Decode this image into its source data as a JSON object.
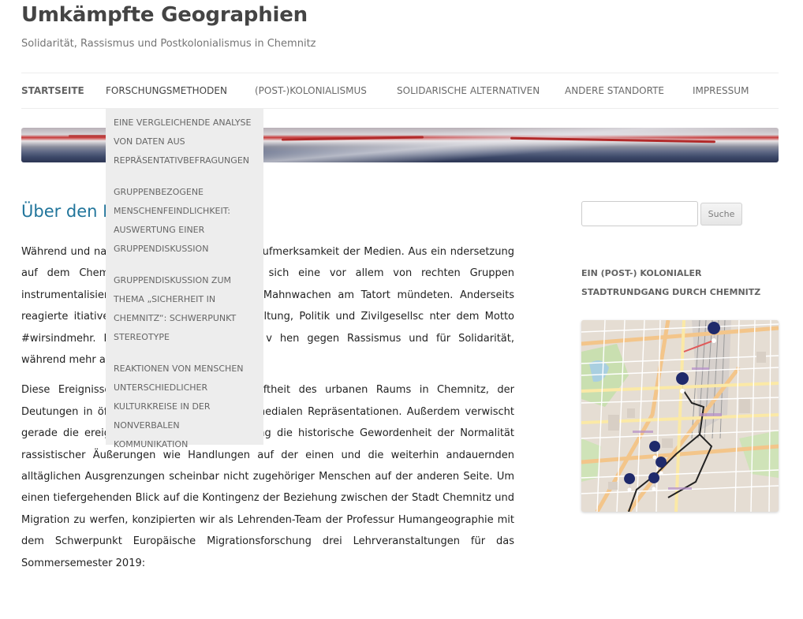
{
  "site": {
    "title": "Umkämpfte Geographien",
    "description": "Solidarität, Rassismus und Postkolonialismus in Chemnitz"
  },
  "nav": {
    "items": [
      {
        "label": "STARTSEITE"
      },
      {
        "label": "FORSCHUNGSMETHODEN"
      },
      {
        "label": "(POST-)KOLONIALISMUS"
      },
      {
        "label": "SOLIDARISCHE ALTERNATIVEN"
      },
      {
        "label": "ANDERE STANDORTE"
      },
      {
        "label": "IMPRESSUM"
      }
    ],
    "dropdown": [
      {
        "label": "EINE VERGLEICHENDE ANALYSE VON DATEN AUS REPRÄSENTATIVBEFRAGUNGEN"
      },
      {
        "label": "GRUPPENBEZOGENE MENSCHENFEINDLICHKEIT: AUSWERTUNG EINER GRUPPENDISKUSSION"
      },
      {
        "label": "GRUPPENDISKUSSION ZUM THEMA „SICHERHEIT IN CHEMNITZ“: SCHWERPUNKT STEREOTYPE"
      },
      {
        "label": "REAKTIONEN VON MENSCHEN UNTERSCHIEDLICHER KULTURKREISE IN DER NONVERBALEN KOMMUNIKATION"
      }
    ]
  },
  "main": {
    "page_title": "Über den B",
    "paragraphs": [
      "Während und na e Chemnitz bundesweit die Aufmerksamkeit der Medien. Aus ein ndersetzung auf dem Chemnitzer Stadtfest entfachten sich eine vor allem von rechten Gruppen instrumentalisiert wurden und in ra später Mahnwachen am Tatort mündeten. Anderseits reagierte itiativen aus Kultur, Bildung, Verwaltung, Politik und Zivilgesellsc nter dem Motto #wirsindmehr. Rund 65.000 BesucherInnen v hen gegen Rassismus und für Solidarität, während mehr als eine Mi eam zuschauten.",
      "Diese Ereignisse zeugen von der Umkämpftheit des urbanen Raums in Chemnitz, der Deutungen in öffentlichen Debatten und in medialen Repräsentationen. Außerdem verwischt gerade die ereignisbezogene Berichterstattung die historische Gewordenheit der Normalität rassistischer Äußerungen wie Handlungen auf der einen und die weiterhin andauernden alltäglichen Ausgrenzungen scheinbar nicht zugehöriger Menschen auf der anderen Seite. Um einen tiefergehenden Blick auf die Kontingenz der Beziehung zwischen der Stadt Chemnitz und Migration zu werfen, konzipierten wir als Lehrenden-Team der Professur Humangeographie mit dem Schwerpunkt Europäische Migrationsforschung drei Lehrveranstaltungen für das Sommersemester 2019:"
    ]
  },
  "sidebar": {
    "search": {
      "value": "",
      "button_label": "Suche"
    },
    "widget_title": "EIN (POST-) KOLONIALER STADTRUNDGANG DURCH CHEMNITZ"
  },
  "colors": {
    "link_blue": "#21759b",
    "dropdown_bg": "#ededed",
    "marker_navy": "#1f2a6b",
    "route_black": "#222222"
  }
}
